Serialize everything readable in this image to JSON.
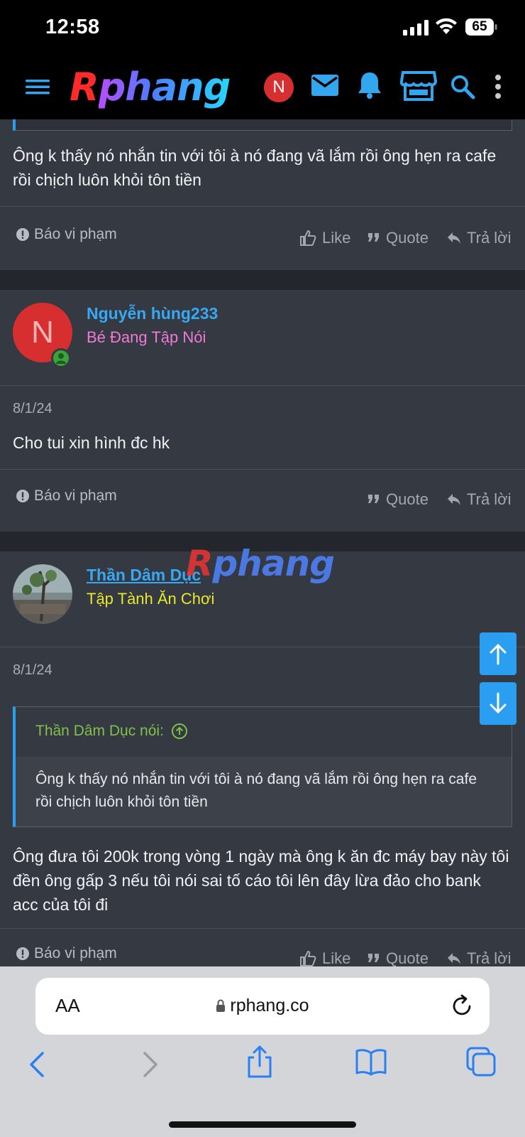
{
  "status": {
    "time": "12:58",
    "battery": "65"
  },
  "header": {
    "logo_r": "R",
    "logo_rest": "phang",
    "avatar_letter": "N"
  },
  "post1": {
    "body": "Ông k thấy nó nhắn tin với tôi à nó đang vã lắm rồi ông hẹn ra cafe rồi chịch luôn khỏi tôn tiền",
    "report": "Báo vi phạm",
    "like": "Like",
    "quote": "Quote",
    "reply": "Trả lời"
  },
  "post2": {
    "avatar_letter": "N",
    "username": "Nguyễn hùng233",
    "user_title": "Bé Đang Tập Nói",
    "user_title_color": "#f07ad6",
    "date": "8/1/24",
    "body": "Cho tui xin hình đc hk",
    "report": "Báo vi phạm",
    "quote": "Quote",
    "reply": "Trả lời"
  },
  "post3": {
    "username": "Thần Dâm Dục",
    "user_title": "Tập Tành Ăn Chơi",
    "user_title_color": "#e8e82a",
    "date": "8/1/24",
    "quote_author": "Thần Dâm Dục nói:",
    "quote_text": "Ông k thấy nó nhắn tin với tôi à nó đang vã lắm rồi ông hẹn ra cafe rồi chịch luôn khỏi tôn tiền",
    "body": "Ông đưa tôi 200k trong vòng 1 ngày mà ông k ăn đc máy bay này tôi đền ông gấp 3 nếu tôi nói sai tố cáo tôi lên đây lừa đảo cho bank acc của tôi đi",
    "report": "Báo vi phạm",
    "like": "Like",
    "quote": "Quote",
    "reply": "Trả lời"
  },
  "watermark": {
    "r": "R",
    "rest": "phang"
  },
  "browser": {
    "text_size": "AA",
    "url": "rphang.co"
  }
}
